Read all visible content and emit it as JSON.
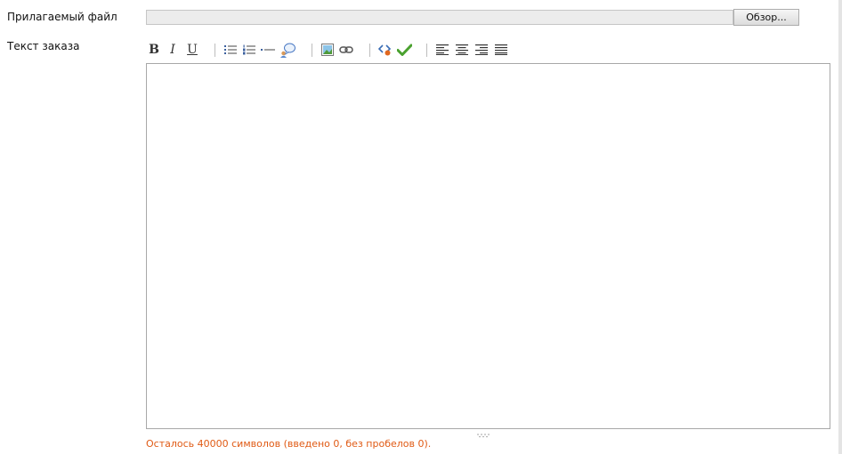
{
  "form": {
    "attachment_label": "Прилагаемый файл",
    "browse_label": "Обзор...",
    "order_text_label": "Текст заказа",
    "char_counter": "Осталось 40000 символов (введено 0, без пробелов 0)."
  },
  "toolbar": {
    "bold": "B",
    "italic": "I",
    "underline": "U",
    "icons": [
      "bulleted-list-icon",
      "numbered-list-icon",
      "horizontal-rule-icon",
      "quote-icon",
      "insert-image-icon",
      "insert-link-icon",
      "source-code-icon",
      "spellcheck-icon",
      "align-left-icon",
      "align-center-icon",
      "align-right-icon",
      "align-justify-icon"
    ]
  },
  "colors": {
    "counter_text": "#e05a14",
    "editor_border": "#a8a8a8",
    "file_field_bg": "#ececec"
  }
}
